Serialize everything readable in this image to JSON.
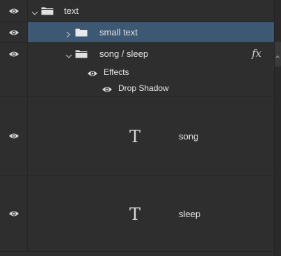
{
  "layers": {
    "text_group": {
      "label": "text"
    },
    "small_text_group": {
      "label": "small text"
    },
    "song_sleep_group": {
      "label": "song / sleep",
      "fx_label": "fx"
    },
    "effects": {
      "label": "Effects"
    },
    "drop_shadow": {
      "label": "Drop Shadow"
    },
    "song_layer": {
      "glyph": "T",
      "label": "song"
    },
    "sleep_layer": {
      "glyph": "T",
      "label": "sleep"
    }
  },
  "colors": {
    "selected_row": "#3d5873",
    "panel_bg": "#2e2e2e"
  }
}
